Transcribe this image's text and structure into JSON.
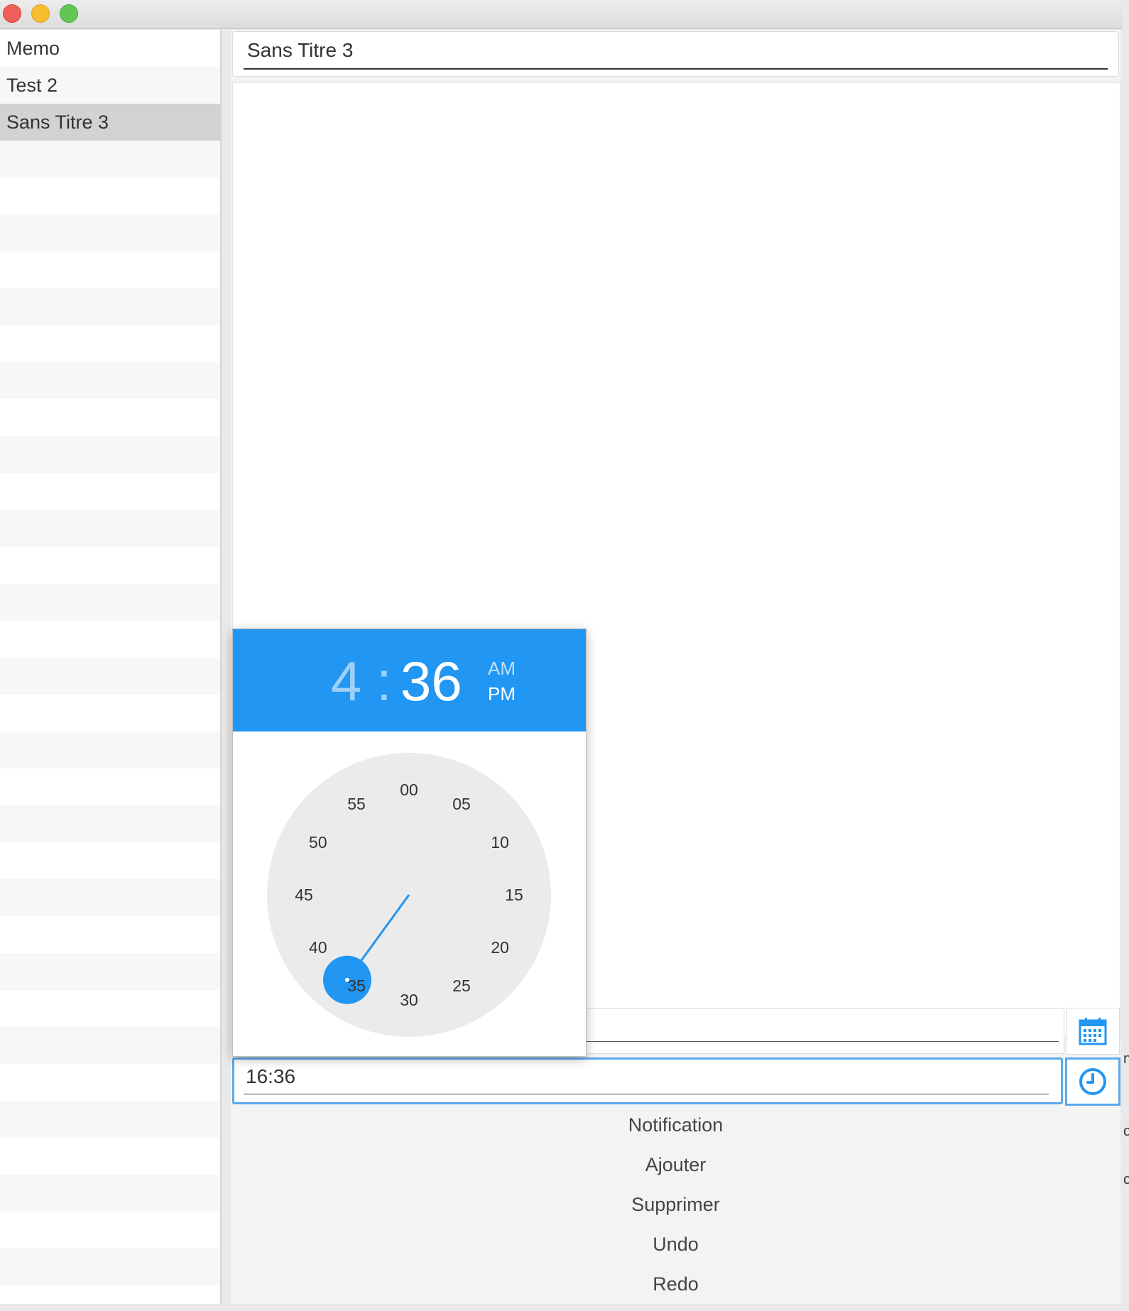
{
  "window": {
    "traffic_lights": [
      "close",
      "minimize",
      "zoom"
    ]
  },
  "sidebar": {
    "items": [
      {
        "label": "Memo",
        "selected": false
      },
      {
        "label": "Test 2",
        "selected": false
      },
      {
        "label": "Sans Titre 3",
        "selected": true
      }
    ]
  },
  "editor": {
    "title_value": "Sans Titre 3",
    "memo_value": "",
    "date_value": "",
    "time_value": "16:36"
  },
  "icons": {
    "date_button": "calendar-icon",
    "time_button": "clock-icon"
  },
  "buttons": {
    "notification": "Notification",
    "ajouter": "Ajouter",
    "supprimer": "Supprimer",
    "undo": "Undo",
    "redo": "Redo"
  },
  "time_picker": {
    "hour": "4",
    "separator": ":",
    "minute": "36",
    "am_label": "AM",
    "pm_label": "PM",
    "period_selected": "PM",
    "selected_minute_mark": "35",
    "minute_labels": [
      "00",
      "05",
      "10",
      "15",
      "20",
      "25",
      "30",
      "35",
      "40",
      "45",
      "50",
      "55"
    ]
  },
  "colors": {
    "accent": "#2196f3",
    "focus_border": "#5aa8ee",
    "dial_face": "#ebebeb",
    "selected_row": "#d2d2d2"
  }
}
